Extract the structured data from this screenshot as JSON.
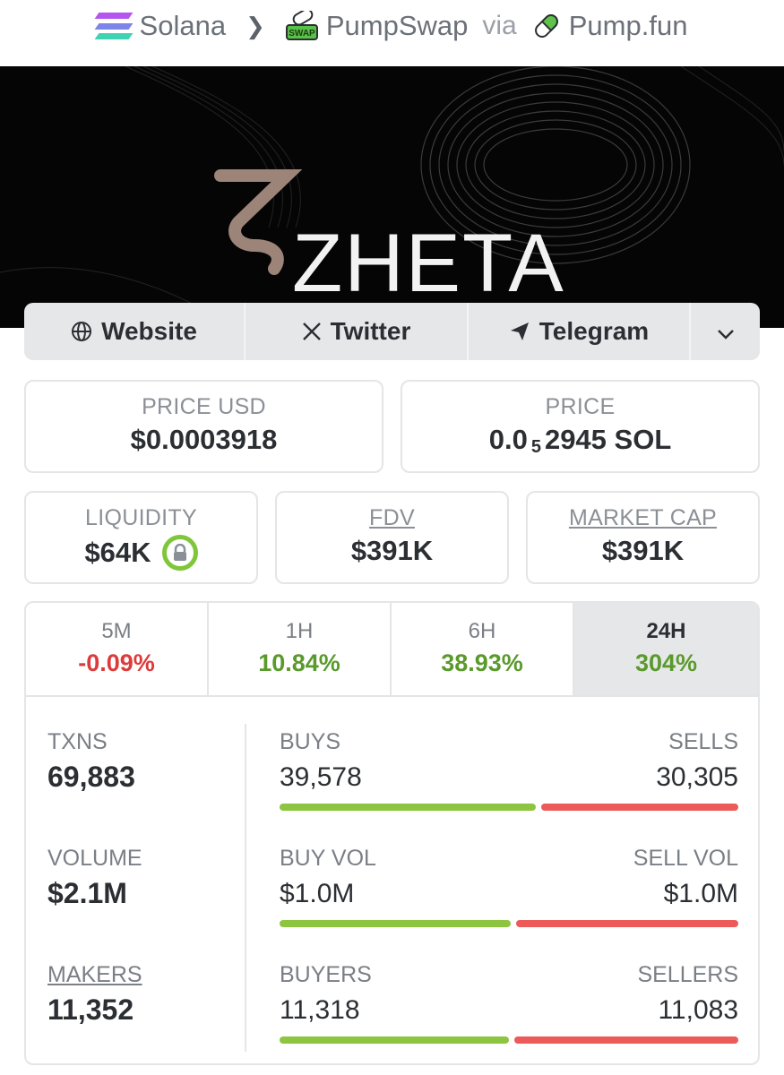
{
  "breadcrumb": {
    "chain": "Solana",
    "dex": "PumpSwap",
    "via": "via",
    "launchpad": "Pump.fun",
    "swap_badge": "SWAP"
  },
  "banner": {
    "logo_text": "ZHETA"
  },
  "links": {
    "website": "Website",
    "twitter": "Twitter",
    "telegram": "Telegram"
  },
  "price": {
    "usd_label": "PRICE USD",
    "usd_value": "$0.0003918",
    "native_label": "PRICE",
    "native_prefix": "0.0",
    "native_zeros": "5",
    "native_suffix": "2945 SOL"
  },
  "metrics": {
    "liquidity_label": "LIQUIDITY",
    "liquidity_value": "$64K",
    "fdv_label": "FDV",
    "fdv_value": "$391K",
    "mcap_label": "MARKET CAP",
    "mcap_value": "$391K"
  },
  "timeframes": [
    {
      "label": "5M",
      "change": "-0.09%"
    },
    {
      "label": "1H",
      "change": "10.84%"
    },
    {
      "label": "6H",
      "change": "38.93%"
    },
    {
      "label": "24H",
      "change": "304%"
    }
  ],
  "stats": {
    "txns_label": "TXNS",
    "txns_value": "69,883",
    "volume_label": "VOLUME",
    "volume_value": "$2.1M",
    "makers_label": "MAKERS",
    "makers_value": "11,352",
    "buys_label": "BUYS",
    "buys_value": "39,578",
    "sells_label": "SELLS",
    "sells_value": "30,305",
    "buy_vol_label": "BUY VOL",
    "buy_vol_value": "$1.0M",
    "sell_vol_label": "SELL VOL",
    "sell_vol_value": "$1.0M",
    "buyers_label": "BUYERS",
    "buyers_value": "11,318",
    "sellers_label": "SELLERS",
    "sellers_value": "11,083"
  },
  "ratios": {
    "txns_buy_fraction": 0.566,
    "volume_buy_fraction": 0.51,
    "traders_buy_fraction": 0.505
  },
  "colors": {
    "positive": "#5a9a2c",
    "negative": "#dc3b3b",
    "buy_bar": "#8dc541",
    "sell_bar": "#ec5a5a"
  }
}
